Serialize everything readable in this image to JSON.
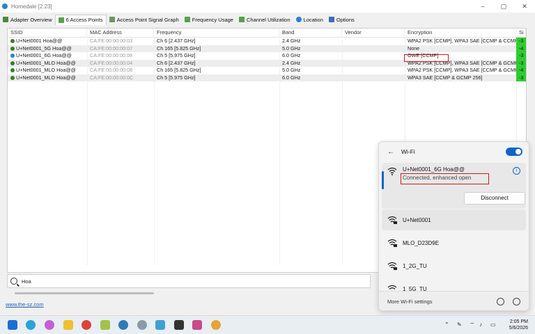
{
  "window": {
    "title": "Homedale [2.23]",
    "controls": [
      "–",
      "▢",
      "✕"
    ]
  },
  "tabs": [
    {
      "label": "Adapter Overview",
      "icon": "adapter-icon"
    },
    {
      "label": "6 Access Points",
      "icon": "access-points-icon"
    },
    {
      "label": "Access Point Signal Graph",
      "icon": "signal-graph-icon"
    },
    {
      "label": "Frequency Usage",
      "icon": "frequency-icon"
    },
    {
      "label": "Channel Utilization",
      "icon": "channel-icon"
    },
    {
      "label": "Location",
      "icon": "location-icon"
    },
    {
      "label": "Options",
      "icon": "options-icon"
    }
  ],
  "table": {
    "columns": [
      "SSID",
      "MAC Address",
      "Frequency",
      "Band",
      "Vendor",
      "Encryption",
      "Si"
    ],
    "rows": [
      {
        "ssid": "U+Net0001 Hoa@@",
        "mac": "CA:FE:00:00:00:03",
        "freq": "Ch 6 [2.437 GHz]",
        "band": "2.4 GHz",
        "vendor": "",
        "enc": "WPA2 PSK [CCMP], WPA3 SAE [CCMP & CCMP ...",
        "sig": "-3"
      },
      {
        "ssid": "U+Net0001_5G Hoa@@",
        "mac": "CA:FE:00:00:00:07",
        "freq": "Ch 165 [5.825 GHz]",
        "band": "5.0 GHz",
        "vendor": "",
        "enc": "None",
        "sig": "-4"
      },
      {
        "ssid": "U+Net0001_6G Hoa@@",
        "mac": "CA:FE:00:00:00:08",
        "freq": "Ch 5 [5.975 GHz]",
        "band": "6.0 GHz",
        "vendor": "",
        "enc": "OWE [CCMP]",
        "sig": "-3"
      },
      {
        "ssid": "U+Net0001_MLO Hoa@@",
        "mac": "CA:FE:00:00:00:04",
        "freq": "Ch 6 [2.437 GHz]",
        "band": "2.4 GHz",
        "vendor": "",
        "enc": "WPA2 PSK [CCMP], WPA3 SAE [CCMP & GCMP ...",
        "sig": "-3"
      },
      {
        "ssid": "U+Net0001_MLO Hoa@@",
        "mac": "CA:FE:00:00:00:08",
        "freq": "Ch 165 [5.825 GHz]",
        "band": "5.0 GHz",
        "vendor": "",
        "enc": "WPA2 PSK [CCMP], WPA3 SAE [CCMP & GCMP ...",
        "sig": "-4"
      },
      {
        "ssid": "U+Net0001_MLO Hoa@@",
        "mac": "CA:FE:00:00:00:0C",
        "freq": "Ch 5 [5.975 GHz]",
        "band": "6.0 GHz",
        "vendor": "",
        "enc": "WPA3 SAE [CCMP & GCMP 256]",
        "sig": "-3"
      }
    ]
  },
  "search": {
    "value": "Hoa"
  },
  "footer": {
    "link": "www.the-sz.com"
  },
  "wifi_flyout": {
    "title": "Wi-Fi",
    "enabled": true,
    "connected": {
      "name": "U+Net0001_6G Hoa@@",
      "status": "Connected, enhanced open",
      "disconnect_label": "Disconnect"
    },
    "networks": [
      "U+Net0001",
      "MLO_D23D9E",
      "1_2G_TU",
      "1_5G_TU"
    ],
    "more_settings": "More Wi-Fi settings"
  },
  "clock": {
    "time": "2:05 PM",
    "date": "5/6/2026"
  },
  "colors": {
    "signal_green": "#2ecc2e",
    "accent": "#1064c8",
    "highlight_red": "#d01818"
  }
}
